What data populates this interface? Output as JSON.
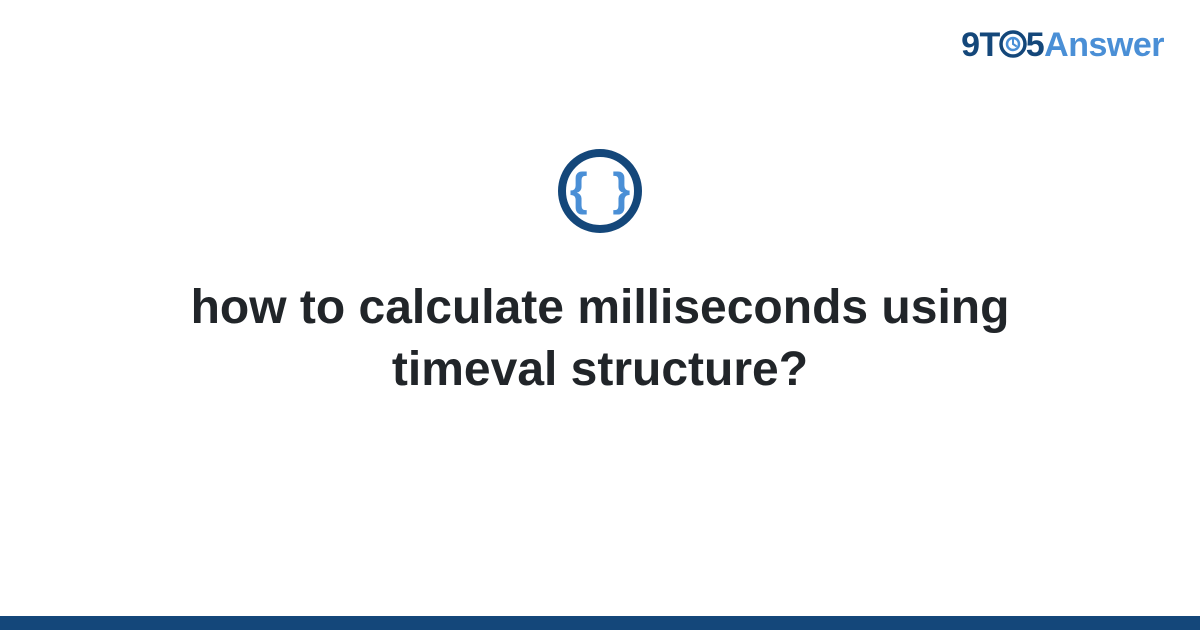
{
  "logo": {
    "part1": "9T",
    "part2": "5",
    "part3": "Answer"
  },
  "icon": {
    "braces_text": "{ }"
  },
  "title": "how to calculate milliseconds using timeval structure?",
  "colors": {
    "primary_dark": "#14477a",
    "primary_light": "#4a8fd6",
    "text": "#212529"
  }
}
